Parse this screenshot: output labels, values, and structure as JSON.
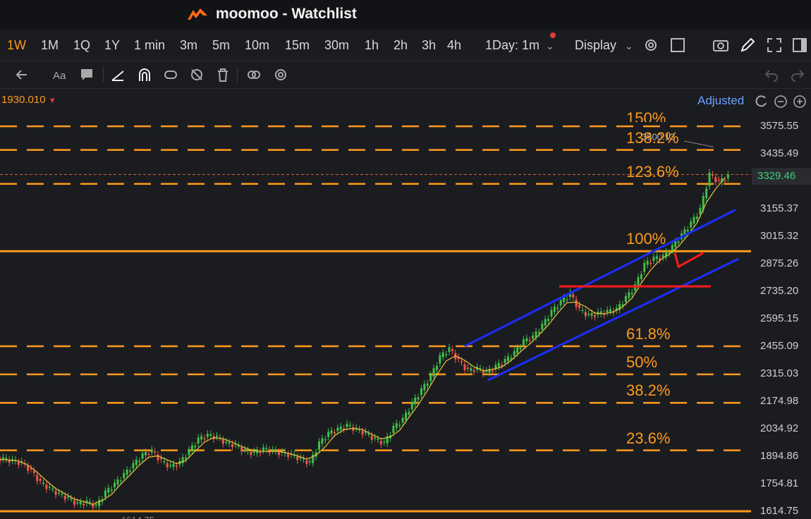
{
  "window": {
    "title": "moomoo - Watchlist"
  },
  "timeframes": [
    {
      "label": "1W",
      "active": true
    },
    {
      "label": "1M",
      "active": false
    },
    {
      "label": "1Q",
      "active": false
    },
    {
      "label": "1Y",
      "active": false
    },
    {
      "label": "1 min",
      "active": false
    },
    {
      "label": "3m",
      "active": false
    },
    {
      "label": "5m",
      "active": false
    },
    {
      "label": "10m",
      "active": false
    },
    {
      "label": "15m",
      "active": false
    },
    {
      "label": "30m",
      "active": false
    },
    {
      "label": "1h",
      "active": false
    },
    {
      "label": "2h",
      "active": false
    },
    {
      "label": "3h",
      "active": false
    },
    {
      "label": "4h",
      "active": false
    }
  ],
  "toolbar": {
    "interval_select": "1Day: 1m",
    "display_menu": "Display"
  },
  "header": {
    "price_readout": "1930.010",
    "adjusted_label": "Adjusted"
  },
  "axis": {
    "ticks": [
      "3575.55",
      "3435.49",
      "3155.37",
      "3015.32",
      "2875.26",
      "2735.20",
      "2595.15",
      "2455.09",
      "2315.03",
      "2174.98",
      "2034.92",
      "1894.86",
      "1754.81",
      "1614.75"
    ],
    "last_price": "3329.46"
  },
  "chart_data": {
    "type": "candlestick",
    "y_ticks": [
      3575.55,
      3435.49,
      3155.37,
      3015.32,
      2875.26,
      2735.2,
      2595.15,
      2455.09,
      2315.03,
      2174.98,
      2034.92,
      1894.86,
      1754.81,
      1614.75
    ],
    "high_label": "3500.13",
    "low_label": "1614.75",
    "last_price": 3329.46,
    "fib_levels": [
      {
        "label": "150%",
        "price": 3575
      },
      {
        "label": "138.2%",
        "price": 3455
      },
      {
        "label": "123.6%",
        "price": 3282
      },
      {
        "label": "100%",
        "price": 2939
      },
      {
        "label": "61.8%",
        "price": 2455
      },
      {
        "label": "50%",
        "price": 2312
      },
      {
        "label": "38.2%",
        "price": 2167
      },
      {
        "label": "23.6%",
        "price": 1925
      }
    ],
    "price_path": [
      1880,
      1870,
      1860,
      1820,
      1760,
      1730,
      1700,
      1680,
      1650,
      1660,
      1640,
      1710,
      1750,
      1800,
      1850,
      1900,
      1920,
      1870,
      1840,
      1860,
      1920,
      1980,
      2000,
      1990,
      1960,
      1950,
      1920,
      1910,
      1930,
      1920,
      1910,
      1900,
      1880,
      1860,
      1960,
      2010,
      2030,
      2050,
      2030,
      2010,
      1980,
      1960,
      2040,
      2080,
      2160,
      2230,
      2300,
      2400,
      2440,
      2380,
      2330,
      2340,
      2320,
      2350,
      2380,
      2420,
      2480,
      2500,
      2560,
      2630,
      2680,
      2720,
      2640,
      2610,
      2620,
      2630,
      2640,
      2700,
      2760,
      2870,
      2900,
      2910,
      2960,
      3020,
      3080,
      3150,
      3330,
      3290,
      3320
    ],
    "annotations": {
      "channel_upper": [
        [
          2455,
          2450
        ],
        [
          3150,
          3200
        ]
      ],
      "channel_lower": [
        [
          2290,
          2282
        ],
        [
          2900,
          2910
        ]
      ],
      "resistance": 2760
    }
  }
}
